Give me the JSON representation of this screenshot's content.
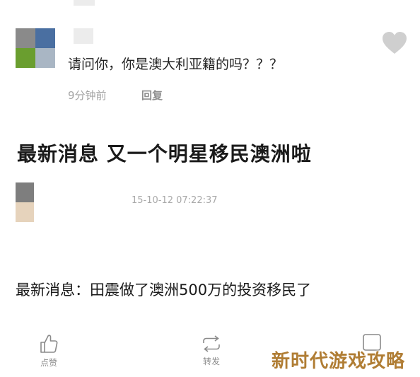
{
  "comment": {
    "text": "请问你，你是澳大利亚籍的吗？？？",
    "time": "9分钟前",
    "reply_label": "回复"
  },
  "headline": "最新消息 又一个明星移民澳洲啦",
  "post": {
    "timestamp": "15-10-12 07:22:37",
    "body": "最新消息：田震做了澳洲500万的投资移民了"
  },
  "actions": {
    "like_label": "点赞",
    "repost_label": "转发"
  },
  "watermark": "新时代游戏攻略",
  "icons": [
    "heart-icon",
    "thumbs-up-icon",
    "repost-icon",
    "comment-icon"
  ],
  "colors": {
    "meta_gray": "#a4a4a4",
    "heart_gray": "#cfcfcf",
    "watermark_gold": "#b07d34"
  }
}
